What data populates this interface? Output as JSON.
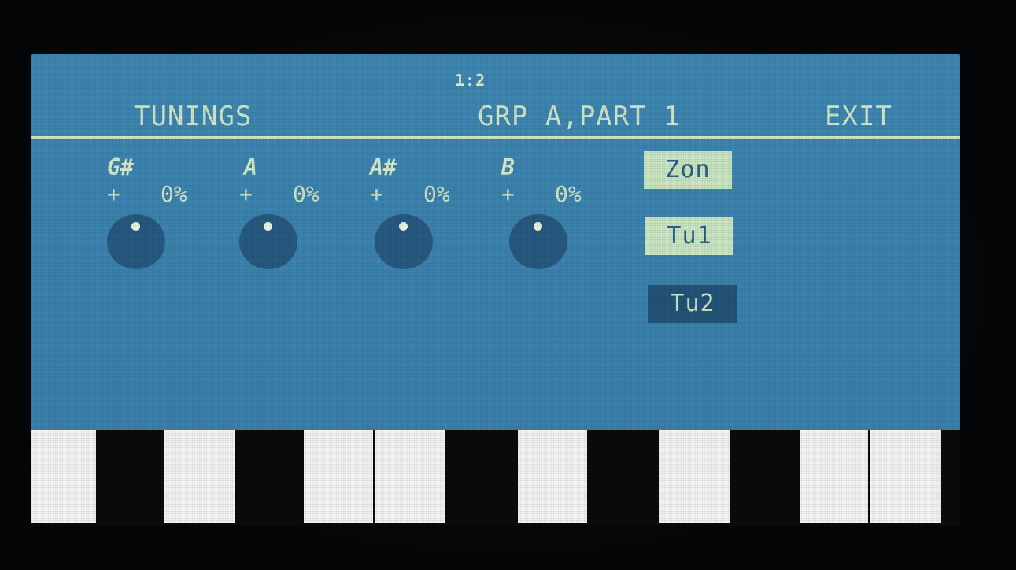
{
  "screen": {
    "id": "1:2",
    "title": "TUNINGS",
    "group": "GRP A,PART 1",
    "exit_label": "EXIT"
  },
  "knobs": [
    {
      "note": "G#",
      "sign": "+",
      "value": "0%"
    },
    {
      "note": "A",
      "sign": "+",
      "value": "0%"
    },
    {
      "note": "A#",
      "sign": "+",
      "value": "0%"
    },
    {
      "note": "B",
      "sign": "+",
      "value": "0%"
    }
  ],
  "buttons": [
    {
      "label": "Zon",
      "state": "on"
    },
    {
      "label": "Tu1",
      "state": "on"
    },
    {
      "label": "Tu2",
      "state": "off"
    }
  ],
  "keyboard": {
    "pattern": [
      "white",
      "black",
      "white",
      "black",
      "white",
      "white",
      "black",
      "white",
      "black",
      "white",
      "black",
      "white",
      "white"
    ]
  },
  "colors": {
    "screen_bg": "#3b82ae",
    "text": "#cfe6c4",
    "knob": "#275a80",
    "button_on": "#c9e5c2",
    "button_off": "#235478"
  }
}
